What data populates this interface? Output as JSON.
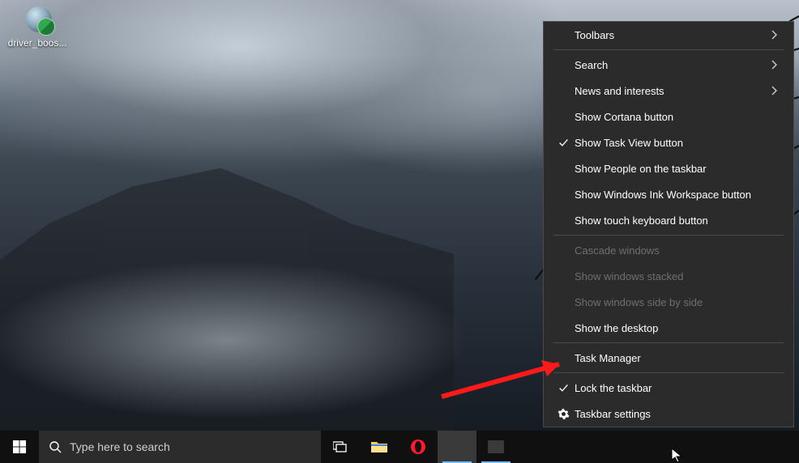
{
  "desktop": {
    "icons": [
      {
        "name": "driver-booster-shortcut",
        "label": "driver_boos..."
      }
    ]
  },
  "context_menu": {
    "items": [
      {
        "id": "toolbars",
        "label": "Toolbars",
        "submenu": true,
        "checked": false,
        "enabled": true
      },
      {
        "sep": true
      },
      {
        "id": "search",
        "label": "Search",
        "submenu": true,
        "checked": false,
        "enabled": true
      },
      {
        "id": "news",
        "label": "News and interests",
        "submenu": true,
        "checked": false,
        "enabled": true
      },
      {
        "id": "cortana",
        "label": "Show Cortana button",
        "submenu": false,
        "checked": false,
        "enabled": true
      },
      {
        "id": "taskview",
        "label": "Show Task View button",
        "submenu": false,
        "checked": true,
        "enabled": true
      },
      {
        "id": "people",
        "label": "Show People on the taskbar",
        "submenu": false,
        "checked": false,
        "enabled": true
      },
      {
        "id": "ink",
        "label": "Show Windows Ink Workspace button",
        "submenu": false,
        "checked": false,
        "enabled": true
      },
      {
        "id": "touchkb",
        "label": "Show touch keyboard button",
        "submenu": false,
        "checked": false,
        "enabled": true
      },
      {
        "sep": true
      },
      {
        "id": "cascade",
        "label": "Cascade windows",
        "submenu": false,
        "checked": false,
        "enabled": false
      },
      {
        "id": "stacked",
        "label": "Show windows stacked",
        "submenu": false,
        "checked": false,
        "enabled": false
      },
      {
        "id": "sidebyside",
        "label": "Show windows side by side",
        "submenu": false,
        "checked": false,
        "enabled": false
      },
      {
        "id": "showdesktop",
        "label": "Show the desktop",
        "submenu": false,
        "checked": false,
        "enabled": true
      },
      {
        "sep": true
      },
      {
        "id": "taskmgr",
        "label": "Task Manager",
        "submenu": false,
        "checked": false,
        "enabled": true
      },
      {
        "sep": true
      },
      {
        "id": "lock",
        "label": "Lock the taskbar",
        "submenu": false,
        "checked": true,
        "enabled": true
      },
      {
        "id": "settings",
        "label": "Taskbar settings",
        "submenu": false,
        "checked": false,
        "enabled": true,
        "icon": "gear"
      }
    ]
  },
  "taskbar": {
    "search_placeholder": "Type here to search",
    "pinned": [
      {
        "id": "taskview",
        "name": "task-view-button",
        "icon": "taskview"
      },
      {
        "id": "explorer",
        "name": "file-explorer",
        "icon": "folder"
      },
      {
        "id": "opera",
        "name": "opera-browser",
        "icon": "opera"
      },
      {
        "id": "app1",
        "name": "running-app-1",
        "icon": "blank",
        "running": true,
        "active": true
      },
      {
        "id": "app2",
        "name": "running-app-2",
        "icon": "blank",
        "running": true
      }
    ]
  }
}
